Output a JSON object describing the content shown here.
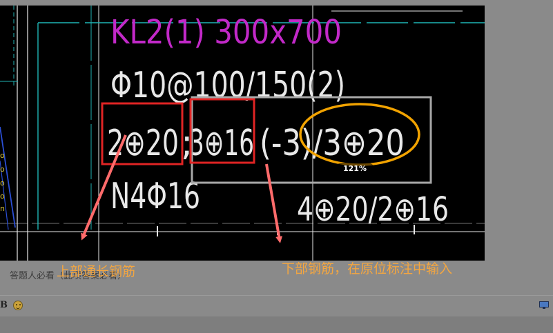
{
  "cad": {
    "title_text": "KL2(1) 300x700",
    "stirrup_text": "Φ10@100/150(2)",
    "top_rebar": "2⊕20",
    "separator": ";",
    "bottom_rebar_1": "3⊕16",
    "bottom_rebar_2": "(-3)/3⊕20",
    "side_rebar": "N4Φ16",
    "in_situ_rebar": "4⊕20/2⊕16"
  },
  "annotations": {
    "top_label": "上部通长钢筋",
    "bottom_label": "下部钢筋，在原位标注中输入",
    "zoom_badge": "121%"
  },
  "page": {
    "answer_hint": "答题人必看（此项答案必看）"
  },
  "toolbar": {
    "bold_label": "B"
  },
  "icons": {
    "emoji": "smiley-icon",
    "monitor": "monitor-icon"
  },
  "colors": {
    "cad_bg": "#000000",
    "cad_white": "#e8e8e8",
    "cad_magenta": "#c229c8",
    "cad_cyan": "#1fb5b5",
    "cad_blue": "#2b4fd6",
    "highlight_red": "#e02424",
    "highlight_orange": "#f2a300",
    "arrow_coral": "#ff6b6b",
    "label_orange": "#f4a640",
    "frame_gray": "#a8a8a8"
  }
}
